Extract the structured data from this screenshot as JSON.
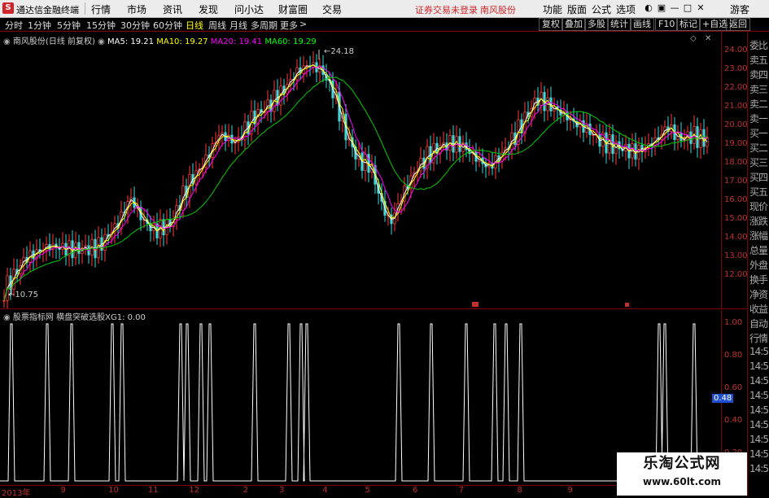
{
  "menubar": {
    "logo": "S",
    "app_title": "通达信金融终端",
    "items": [
      "行情",
      "市场",
      "资讯",
      "发现",
      "问小达",
      "财富圈",
      "交易"
    ],
    "status_red": "证券交易未登录",
    "stock_red": "南风股份",
    "right_items": [
      "功能",
      "版面",
      "公式",
      "选项"
    ],
    "user": "游客"
  },
  "toolbar": {
    "periods": [
      "分时",
      "1分钟",
      "5分钟",
      "15分钟",
      "30分钟",
      "60分钟",
      "日线",
      "周线",
      "月线",
      "多周期",
      "更多"
    ],
    "active": "日线",
    "right_buttons": [
      "复权",
      "叠加",
      "多股",
      "统计",
      "画线",
      "F10",
      "标记",
      "+自选",
      "返回"
    ]
  },
  "price_chart": {
    "title": "南风股份(日线 前复权)",
    "ma": [
      {
        "label": "MA5: 19.21",
        "color": "#ffffff"
      },
      {
        "label": "MA10: 19.27",
        "color": "#ffff00"
      },
      {
        "label": "MA20: 19.41",
        "color": "#ff00ff"
      },
      {
        "label": "MA60: 19.29",
        "color": "#00ff00"
      }
    ],
    "high_label": "24.18",
    "low_label": "10.75",
    "price_ticks": [
      "24.00",
      "23.00",
      "22.00",
      "21.00",
      "20.00",
      "19.00",
      "18.00",
      "17.00",
      "16.00",
      "15.00",
      "14.00",
      "13.00",
      "12.00"
    ]
  },
  "right_panel": {
    "items": [
      "委比",
      "卖五",
      "卖四",
      "卖三",
      "卖二",
      "卖一",
      "买一",
      "买二",
      "买三",
      "买四",
      "买五",
      "现价",
      "涨跌",
      "涨幅",
      "总量",
      "外盘",
      "换手",
      "净资",
      "收益",
      "自动",
      "行情",
      "14:5",
      "14:5",
      "14:5",
      "14:5",
      "14:5",
      "14:5",
      "14:5",
      "14:5",
      "14:5"
    ]
  },
  "indicator": {
    "title": "股票指标网",
    "formula": "横盘突破选股XG1: 0.00",
    "ticks": [
      "1.00",
      "0.80",
      "0.60",
      "0.40",
      "0.20"
    ],
    "current_value": "0.48",
    "spikes": [
      14,
      58,
      88,
      138,
      150,
      222,
      230,
      247,
      258,
      313,
      355,
      370,
      377,
      490,
      530,
      573,
      608,
      622,
      640,
      810,
      817,
      853
    ]
  },
  "time_axis": {
    "labels": [
      {
        "text": "2013年",
        "at": 0.0
      },
      {
        "text": "9",
        "at": 0.082
      },
      {
        "text": "10",
        "at": 0.148
      },
      {
        "text": "11",
        "at": 0.203
      },
      {
        "text": "12",
        "at": 0.26
      },
      {
        "text": "2",
        "at": 0.335
      },
      {
        "text": "3",
        "at": 0.385
      },
      {
        "text": "4",
        "at": 0.445
      },
      {
        "text": "5",
        "at": 0.504
      },
      {
        "text": "6",
        "at": 0.57
      },
      {
        "text": "7",
        "at": 0.634
      },
      {
        "text": "8",
        "at": 0.715
      },
      {
        "text": "9",
        "at": 0.785
      }
    ]
  },
  "watermark": {
    "name": "乐淘公式网",
    "url": "www.60lt.com"
  }
}
